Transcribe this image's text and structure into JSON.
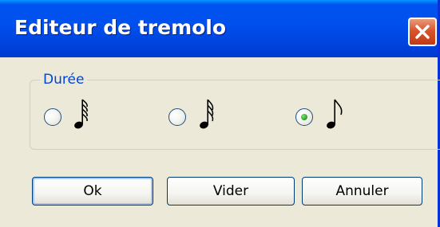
{
  "window": {
    "title": "Editeur de tremolo"
  },
  "group": {
    "label": "Durée",
    "options": [
      {
        "icon": "sixty-fourth-note-icon",
        "selected": false
      },
      {
        "icon": "thirty-second-note-icon",
        "selected": false
      },
      {
        "icon": "sixteenth-note-icon",
        "selected": true
      }
    ]
  },
  "buttons": {
    "ok": "Ok",
    "clear": "Vider",
    "cancel": "Annuler"
  },
  "colors": {
    "titlebar": "#0053EE",
    "close": "#D9542C",
    "face": "#ECE9D8",
    "group_label": "#0046D5",
    "radio_dot": "#2FA92F"
  }
}
